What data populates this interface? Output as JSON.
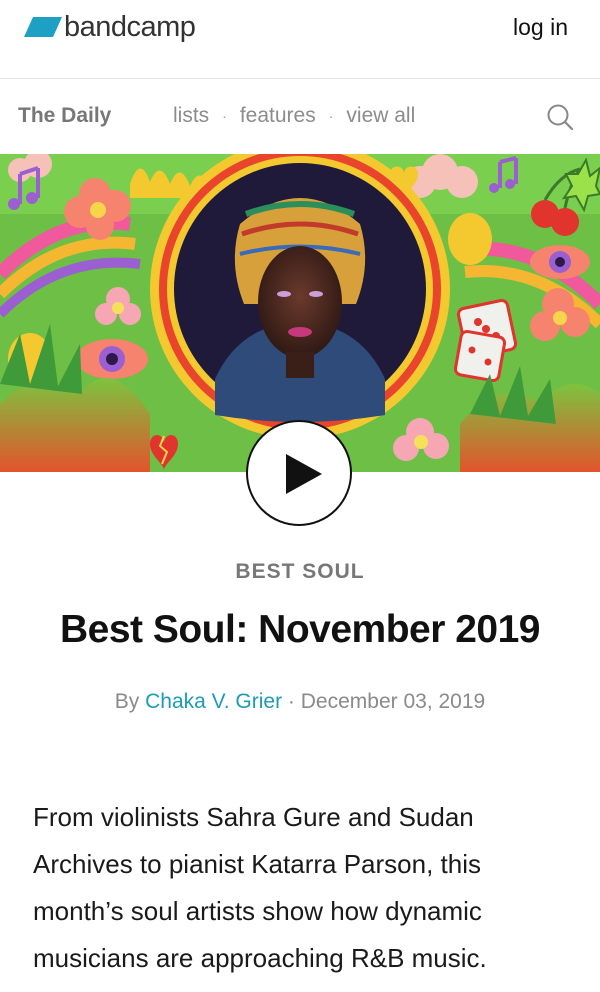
{
  "header": {
    "logo_text": "bandcamp",
    "login_label": "log in"
  },
  "daily_nav": {
    "title": "The Daily",
    "links": [
      "lists",
      "features",
      "view all"
    ],
    "separator": "·"
  },
  "article": {
    "category": "BEST SOUL",
    "title": "Best Soul: November 2019",
    "byline_prefix": "By",
    "author": "Chaka V. Grier",
    "date_separator": "·",
    "date": "December 03, 2019",
    "intro": "From violinists Sahra Gure and Sudan Archives to pianist Katarra Parson, this month’s soul artists show how dynamic musicians are approaching R&B music."
  },
  "colors": {
    "logo_blue": "#1da0c3",
    "link_teal": "#1d9bb5",
    "hero_green": "#6cc04a",
    "portrait_ring": "#e8452c"
  },
  "icons": {
    "search": "search-icon",
    "play": "play-icon"
  }
}
